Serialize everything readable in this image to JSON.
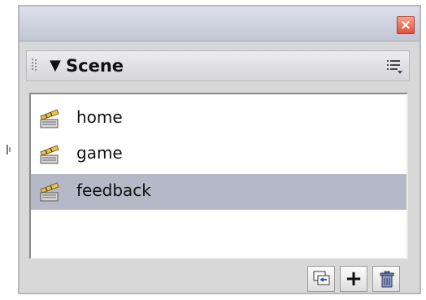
{
  "window": {
    "close_label": "×"
  },
  "panel": {
    "title": "Scene"
  },
  "scenes": [
    {
      "label": "home",
      "selected": false
    },
    {
      "label": "game",
      "selected": false
    },
    {
      "label": "feedback",
      "selected": true
    }
  ],
  "footer": {
    "add_label": "+"
  },
  "colors": {
    "selection": "#b5b8c6",
    "close": "#e0503a",
    "titlebar": "#c2c6d4"
  },
  "icons": {
    "scene": "clapperboard-icon",
    "duplicate": "duplicate-scene-icon",
    "delete": "trash-icon",
    "options": "panel-options-icon"
  }
}
